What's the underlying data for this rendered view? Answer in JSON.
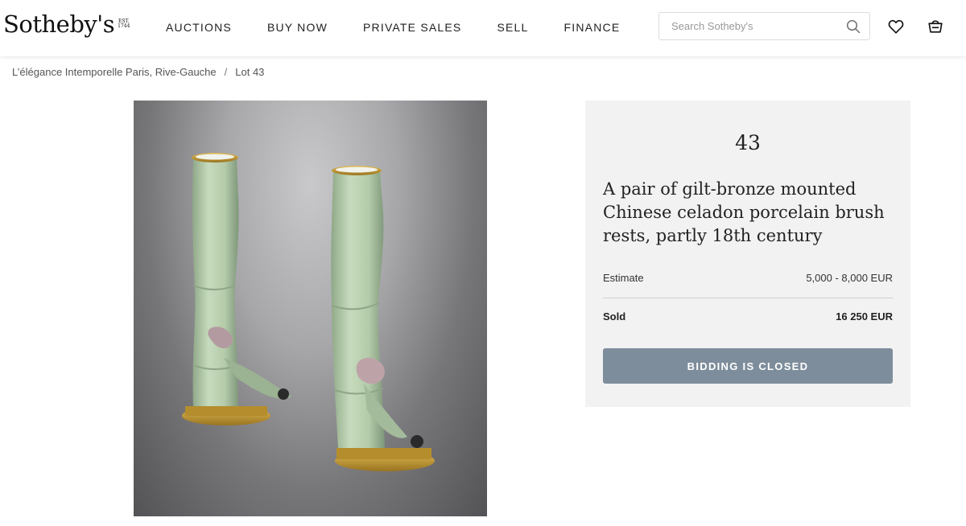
{
  "brand": {
    "name": "Sotheby's",
    "est_mark": [
      "EST.",
      "1744"
    ]
  },
  "nav": {
    "items": [
      "AUCTIONS",
      "BUY NOW",
      "PRIVATE SALES",
      "SELL",
      "FINANCE"
    ]
  },
  "search": {
    "placeholder": "Search Sotheby's",
    "value": ""
  },
  "icons": {
    "search": "search-icon",
    "favorites": "heart-icon",
    "bag": "shopping-bag-icon"
  },
  "breadcrumb": {
    "sale": "L’élégance Intemporelle Paris, Rive-Gauche",
    "separator": "/",
    "lot": "Lot 43"
  },
  "lot": {
    "number": "43",
    "title": "A pair of gilt-bronze mounted Chinese celadon porcelain brush rests, partly 18th century",
    "estimate_label": "Estimate",
    "estimate_value": "5,000 - 8,000 EUR",
    "sold_label": "Sold",
    "sold_value": "16 250 EUR",
    "status_button": "BIDDING IS CLOSED"
  },
  "colors": {
    "button_bg": "#7e8d9b",
    "panel_bg": "#f2f2f2",
    "celadon": "#b9cfb0",
    "gilt": "#c79a32"
  }
}
